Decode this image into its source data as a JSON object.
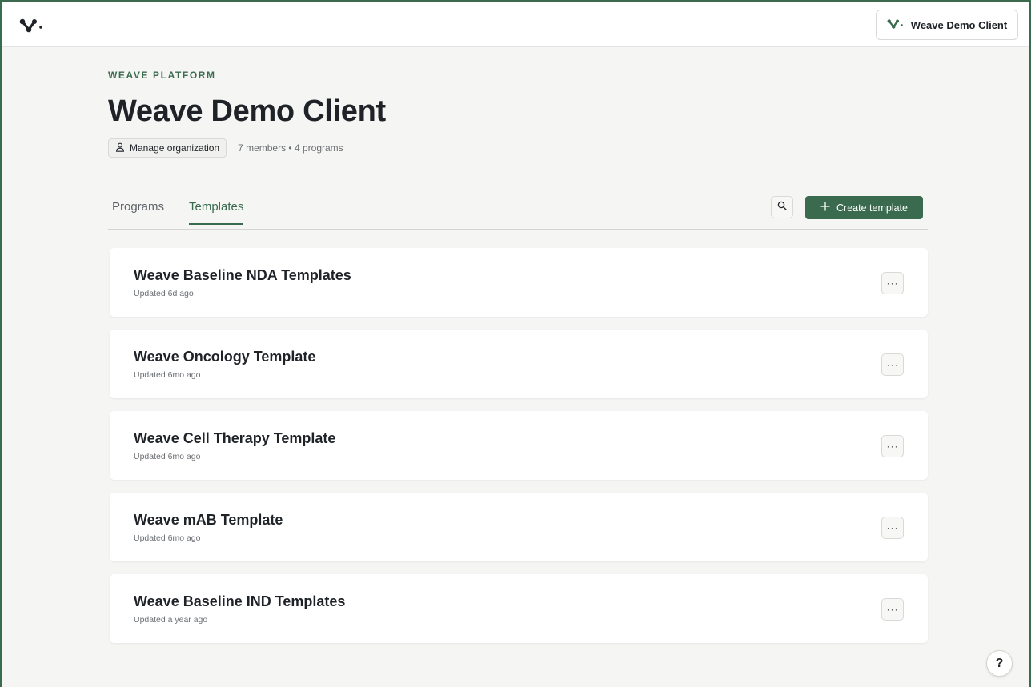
{
  "header": {
    "logo_icon": "weave-logo-icon",
    "org_switcher_label": "Weave Demo Client"
  },
  "page": {
    "eyebrow": "WEAVE PLATFORM",
    "title": "Weave Demo Client",
    "manage_label": "Manage organization",
    "meta_text": "7 members • 4 programs"
  },
  "tabs": [
    {
      "label": "Programs",
      "active": false
    },
    {
      "label": "Templates",
      "active": true
    }
  ],
  "actions": {
    "search_icon": "search-icon",
    "create_label": "Create template"
  },
  "templates": [
    {
      "title": "Weave Baseline NDA Templates",
      "updated": "Updated 6d ago"
    },
    {
      "title": "Weave Oncology Template",
      "updated": "Updated 6mo ago"
    },
    {
      "title": "Weave Cell Therapy Template",
      "updated": "Updated 6mo ago"
    },
    {
      "title": "Weave mAB Template",
      "updated": "Updated 6mo ago"
    },
    {
      "title": "Weave Baseline IND Templates",
      "updated": "Updated a year ago"
    }
  ],
  "more_label": "···",
  "help_label": "?",
  "colors": {
    "accent": "#3b6b4e",
    "background": "#f5f5f4",
    "card": "#ffffff"
  }
}
